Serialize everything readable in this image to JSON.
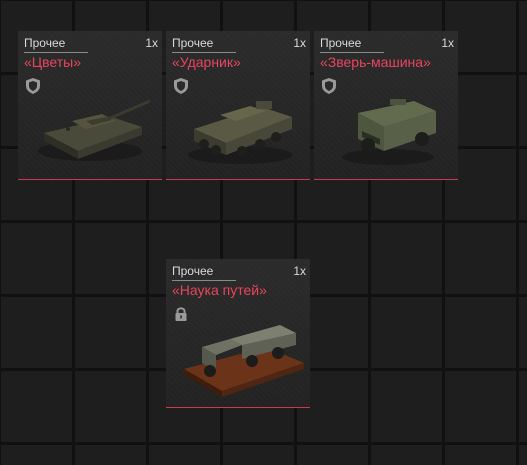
{
  "inventory": {
    "cards": [
      {
        "category": "Прочее",
        "quantity": "1x",
        "name": "«Цветы»",
        "badge": "shield-icon",
        "art": "light-tank-icon"
      },
      {
        "category": "Прочее",
        "quantity": "1x",
        "name": "«Ударник»",
        "badge": "shield-icon",
        "art": "armored-carrier-icon"
      },
      {
        "category": "Прочее",
        "quantity": "1x",
        "name": "«Зверь-машина»",
        "badge": "shield-icon",
        "art": "armored-car-icon"
      },
      {
        "category": "Прочее",
        "quantity": "1x",
        "name": "«Наука путей»",
        "badge": "lock-icon",
        "art": "truck-on-stand-icon"
      }
    ]
  },
  "colors": {
    "accent": "#e8455c",
    "background": "#1e1e1e",
    "grid_line": "#111111"
  }
}
